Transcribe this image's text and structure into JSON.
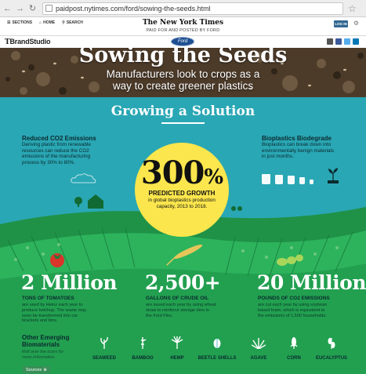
{
  "browser": {
    "url": "paidpost.nytimes.com/ford/sowing-the-seeds.html",
    "back_icon": "back-arrow-icon",
    "forward_icon": "forward-arrow-icon",
    "reload_icon": "reload-icon",
    "star_icon": "bookmark-star-icon"
  },
  "nyt_header": {
    "sections_label": "SECTIONS",
    "home_label": "HOME",
    "search_label": "SEARCH",
    "logo": "The New York Times",
    "paid_label": "PAID FOR AND POSTED BY FORD",
    "login_label": "LOG IN"
  },
  "brand_bar": {
    "logo_prefix": "T",
    "logo_text": "BrandStudio",
    "sponsor_logo": "Ford"
  },
  "hero": {
    "title": "Sowing the Seeds",
    "subtitle_line1": "Manufacturers look to crops as a",
    "subtitle_line2": "way to create greener plastics"
  },
  "infographic": {
    "heading": "Growing a Solution",
    "left_block": {
      "title": "Reduced CO2 Emissions",
      "text_lines": [
        "Deriving plastic from renewable",
        "resources can reduce the CO2",
        "emissions of the manufacturing",
        "process by 30% to 80%."
      ]
    },
    "right_block": {
      "title": "Bioplastics Biodegrade",
      "text_lines": [
        "Bioplastics can break down into",
        "environmentally benign materials",
        "in just months."
      ]
    },
    "center": {
      "value": "300",
      "unit": "%",
      "label": "PREDICTED GROWTH",
      "text_lines": [
        "in global bioplastics production",
        "capacity, 2013 to 2018."
      ]
    },
    "stats": [
      {
        "value": "2 Million",
        "label": "TONS OF TOMATOES",
        "text_lines": [
          "are used by Heinz each year to",
          "produce ketchup. The waste may",
          "soon be transformed into car",
          "brackets and bins."
        ]
      },
      {
        "value": "2,500+",
        "label": "GALLONS OF CRUDE OIL",
        "text_lines": [
          "are saved each year by using wheat",
          "straw to reinforce storage bins in",
          "the Ford Flex."
        ]
      },
      {
        "value": "20 Million",
        "label": "POUNDS OF CO2 EMISSIONS",
        "text_lines": [
          "are cut each year by using soybean",
          "based foam, which is equivalent to",
          "the emissions of 1,500 households."
        ]
      }
    ],
    "other": {
      "title_line1": "Other Emerging",
      "title_line2": "Biomaterials",
      "text_lines": [
        "Roll over the icons for",
        "more information."
      ],
      "sources_label": "Sources"
    },
    "plants": [
      "SEAWEED",
      "BAMBOO",
      "HEMP",
      "BEETLE SHELLS",
      "AGAVE",
      "CORN",
      "EUCALYPTUS"
    ],
    "colors": {
      "sky": "#2aa7b4",
      "sun": "#fbe64d",
      "field_dark": "#1f9247",
      "field_light": "#2db35c",
      "tomato": "#d9352a",
      "soybean": "#a9d65a"
    }
  }
}
